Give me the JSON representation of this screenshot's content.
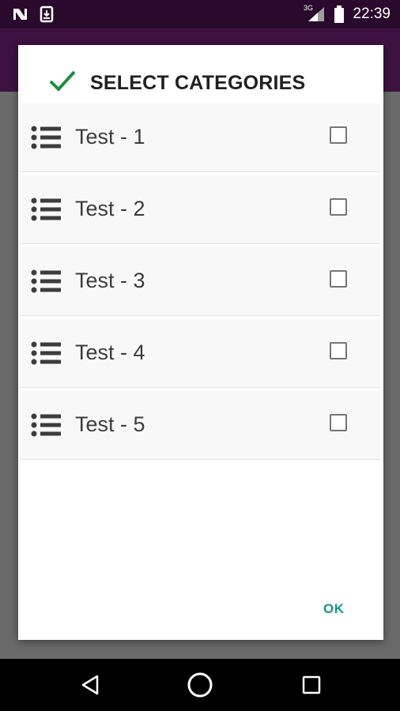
{
  "status_bar": {
    "time": "22:39",
    "network": "3G",
    "icons": [
      "n-logo-icon",
      "download-notification-icon",
      "signal-icon",
      "battery-icon"
    ]
  },
  "dialog": {
    "title": "SELECT CATEGORIES",
    "title_icon": "check-icon",
    "items": [
      {
        "label": "Test - 1",
        "checked": false,
        "icon": "list-icon"
      },
      {
        "label": "Test - 2",
        "checked": false,
        "icon": "list-icon"
      },
      {
        "label": "Test - 3",
        "checked": false,
        "icon": "list-icon"
      },
      {
        "label": "Test - 4",
        "checked": false,
        "icon": "list-icon"
      },
      {
        "label": "Test - 5",
        "checked": false,
        "icon": "list-icon"
      }
    ],
    "ok_label": "OK"
  },
  "nav_bar": {
    "buttons": [
      "back-icon",
      "home-icon",
      "recents-icon"
    ]
  },
  "colors": {
    "status_bar": "#2a0a2c",
    "app_bar": "#3d1240",
    "check": "#1e8e3e",
    "accent": "#159688"
  }
}
